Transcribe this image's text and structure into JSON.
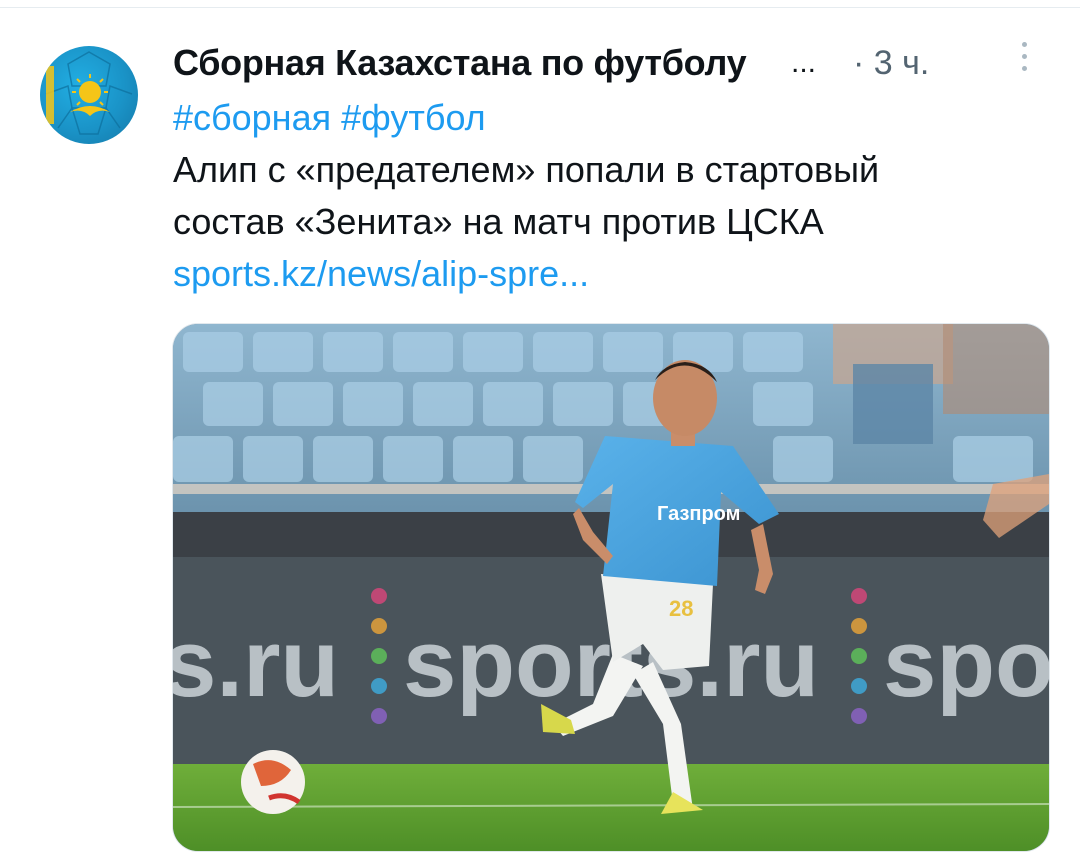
{
  "post": {
    "author_name": "Сборная Казахстана по футболу",
    "author_truncation": "...",
    "time": "· 3 ч.",
    "hashtags": [
      "#сборная",
      "#футбол"
    ],
    "text_line1": "Алип с «предателем» попали в стартовый",
    "text_line2": "состав «Зенита» на матч против ЦСКА",
    "link": "sports.kz/news/alip-spre...",
    "image": {
      "banner_text": "sports.ru",
      "player_number": "28",
      "sponsor": "Газпром"
    }
  },
  "colors": {
    "link": "#1d9bf0",
    "text": "#0f1419",
    "muted": "#536471"
  },
  "icons": {
    "more": "vertical-dots-icon",
    "avatar": "kazakhstan-football-logo"
  }
}
